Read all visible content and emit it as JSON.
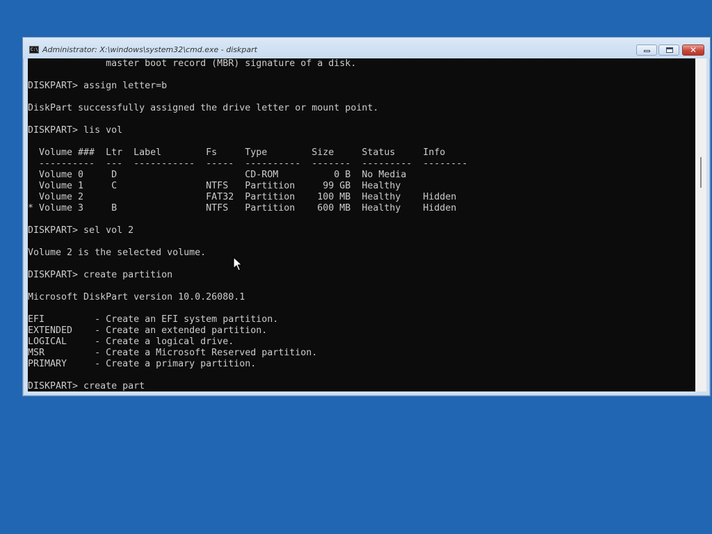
{
  "window": {
    "title": "Administrator: X:\\windows\\system32\\cmd.exe - diskpart",
    "icon": "cmd-icon",
    "icon_text": "C:\\",
    "close_glyph": "✕"
  },
  "console": {
    "lines": [
      "              master boot record (MBR) signature of a disk.",
      "",
      "DISKPART> assign letter=b",
      "",
      "DiskPart successfully assigned the drive letter or mount point.",
      "",
      "DISKPART> lis vol",
      "",
      "  Volume ###  Ltr  Label        Fs     Type        Size     Status     Info",
      "  ----------  ---  -----------  -----  ----------  -------  ---------  --------",
      "  Volume 0     D                       CD-ROM          0 B  No Media",
      "  Volume 1     C                NTFS   Partition     99 GB  Healthy",
      "  Volume 2                      FAT32  Partition    100 MB  Healthy    Hidden",
      "* Volume 3     B                NTFS   Partition    600 MB  Healthy    Hidden",
      "",
      "DISKPART> sel vol 2",
      "",
      "Volume 2 is the selected volume.",
      "",
      "DISKPART> create partition",
      "",
      "Microsoft DiskPart version 10.0.26080.1",
      "",
      "EFI         - Create an EFI system partition.",
      "EXTENDED    - Create an extended partition.",
      "LOGICAL     - Create a logical drive.",
      "MSR         - Create a Microsoft Reserved partition.",
      "PRIMARY     - Create a primary partition.",
      "",
      "DISKPART> create part"
    ]
  },
  "colors": {
    "desktop": "#2166b3",
    "console_bg": "#0c0c0c",
    "console_fg": "#cccccc",
    "close_button": "#c9473a"
  }
}
